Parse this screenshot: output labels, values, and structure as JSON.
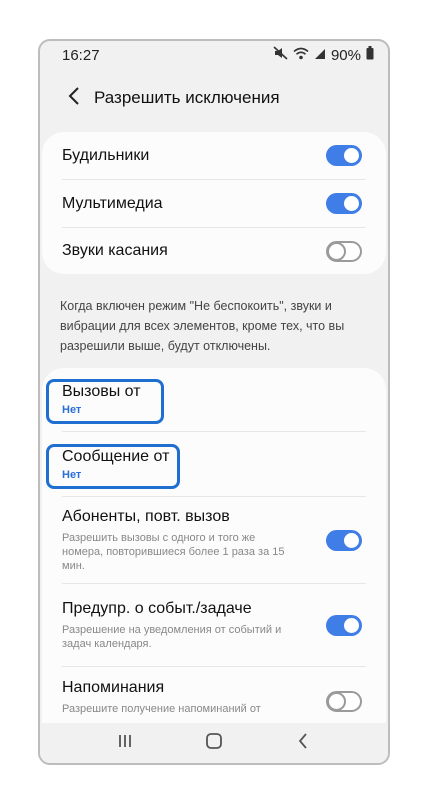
{
  "status_bar": {
    "time": "16:27",
    "battery": "90%",
    "icons": [
      "mute-icon",
      "wifi-icon",
      "signal-icon",
      "battery-icon"
    ]
  },
  "header": {
    "title": "Разрешить исключения",
    "back_icon": "back-arrow-icon"
  },
  "toggles_group": [
    {
      "label": "Будильники",
      "enabled": true
    },
    {
      "label": "Мультимедиа",
      "enabled": true
    },
    {
      "label": "Звуки касания",
      "enabled": false
    }
  ],
  "info_text": "Когда включен режим \"Не беспокоить\", звуки и вибрации для всех элементов, кроме тех, что вы разрешили выше, будут отключены.",
  "calls": {
    "label": "Вызовы от",
    "value": "Нет"
  },
  "messages": {
    "label": "Сообщение от",
    "value": "Нет"
  },
  "repeat_callers": {
    "label": "Абоненты, повт. вызов",
    "description": "Разрешить вызовы с одного и того же номера, повторившиеся более 1 раза за 15 мин.",
    "enabled": true
  },
  "events": {
    "label": "Предупр. о событ./задаче",
    "description": "Разрешение на уведомления от событий и задач календаря.",
    "enabled": true
  },
  "reminders": {
    "label": "Напоминания",
    "description": "Разрешите получение напоминаний от",
    "enabled": false
  },
  "colors": {
    "accent": "#3e7ee6",
    "highlight": "#1f6fd1",
    "sub_value": "#2b6fd6",
    "background": "#f1f1f1"
  },
  "nav_bar": [
    "recents-icon",
    "home-icon",
    "back-icon"
  ]
}
